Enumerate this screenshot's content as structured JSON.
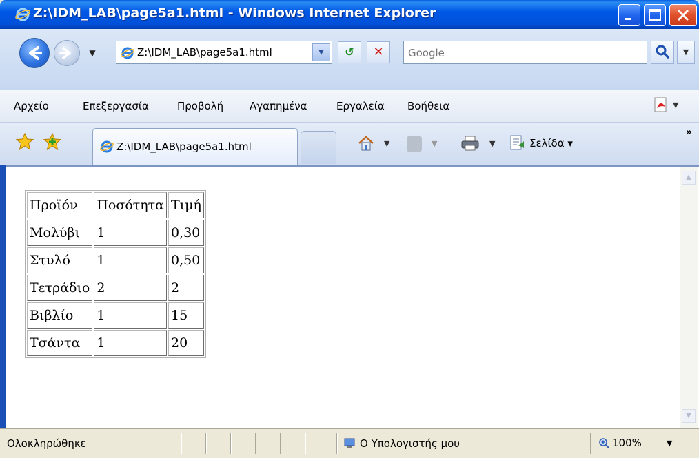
{
  "window": {
    "title": "Z:\\IDM_LAB\\page5a1.html - Windows Internet Explorer"
  },
  "nav": {
    "address": "Z:\\IDM_LAB\\page5a1.html",
    "search_placeholder": "Google"
  },
  "menu": {
    "items": [
      "Αρχείο",
      "Επεξεργασία",
      "Προβολή",
      "Αγαπημένα",
      "Εργαλεία",
      "Βοήθεια"
    ]
  },
  "tabs": {
    "active_label": "Z:\\IDM_LAB\\page5a1.html"
  },
  "command_bar": {
    "page_label": "Σελίδα ▾"
  },
  "table": {
    "headers": [
      "Προϊόν",
      "Ποσότητα",
      "Τιμή"
    ],
    "rows": [
      [
        "Μολύβι",
        "1",
        "0,30"
      ],
      [
        "Στυλό",
        "1",
        "0,50"
      ],
      [
        "Τετράδιο",
        "2",
        "2"
      ],
      [
        "Βιβλίο",
        "1",
        "15"
      ],
      [
        "Τσάντα",
        "1",
        "20"
      ]
    ]
  },
  "status": {
    "text": "Ολοκληρώθηκε",
    "zone": "Ο Υπολογιστής μου",
    "zoom": "100%"
  },
  "colors": {
    "titlebar": "#0058e6",
    "close_button": "#e0502a"
  },
  "icons": [
    "ie-icon",
    "back-arrow-icon",
    "forward-arrow-icon",
    "refresh-icon",
    "stop-icon",
    "search-icon",
    "pdf-icon",
    "favorites-star-icon",
    "add-favorite-icon",
    "home-icon",
    "feed-icon",
    "print-icon",
    "page-icon",
    "computer-icon",
    "zoom-icon"
  ]
}
